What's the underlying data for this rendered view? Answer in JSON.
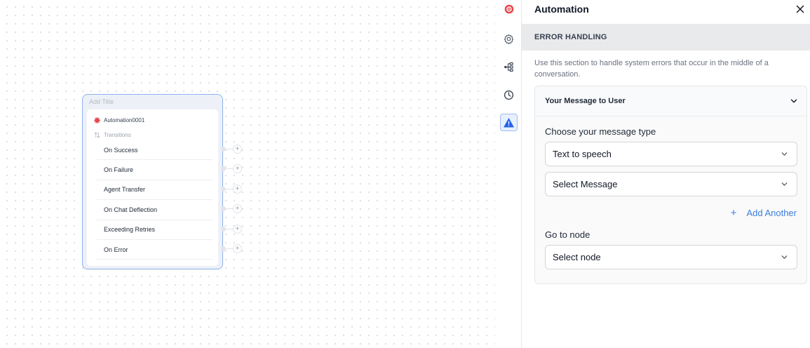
{
  "canvas": {
    "node": {
      "title_placeholder": "Add Title",
      "name": "Automation0001",
      "transitions_label": "Transitions",
      "transitions": [
        {
          "label": "On Success"
        },
        {
          "label": "On Failure"
        },
        {
          "label": "Agent Transfer"
        },
        {
          "label": "On Chat Deflection"
        },
        {
          "label": "Exceeding Retries"
        },
        {
          "label": "On Error"
        }
      ],
      "add_button_glyph": "+"
    }
  },
  "rail": {
    "items": [
      {
        "icon": "automation-icon"
      },
      {
        "icon": "gear-icon"
      },
      {
        "icon": "flow-icon"
      },
      {
        "icon": "clock-icon"
      },
      {
        "icon": "warning-icon",
        "active": true
      }
    ]
  },
  "panel": {
    "title": "Automation",
    "section_title": "ERROR HANDLING",
    "description": "Use this section to handle system errors that occur in the middle of a conversation.",
    "card": {
      "title": "Your Message to User",
      "message_type_label": "Choose your message type",
      "message_type_value": "Text to speech",
      "message_select_value": "Select Message",
      "add_another_glyph": "+",
      "add_another_label": "Add Another",
      "goto_label": "Go to node",
      "goto_value": "Select node"
    }
  },
  "colors": {
    "accent": "#3b7ddd",
    "brand_red": "#e5484d",
    "node_border": "#8fb3f0"
  }
}
